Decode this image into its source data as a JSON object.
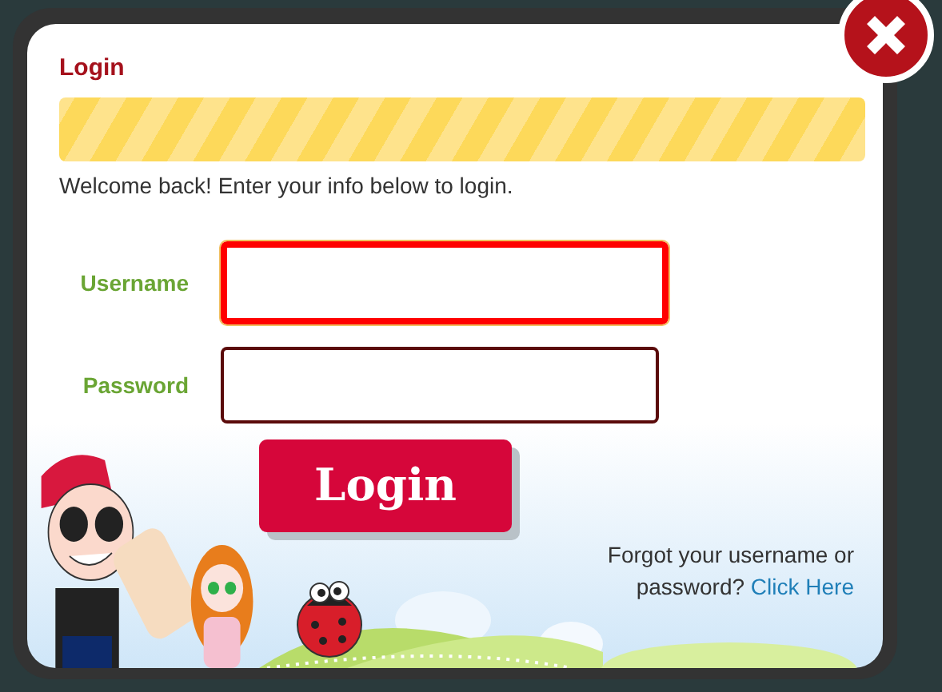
{
  "dialog": {
    "title": "Login",
    "intro": "Welcome back! Enter your info below to login."
  },
  "fields": [
    {
      "label": "Username",
      "focused": true
    },
    {
      "label": "Password",
      "focused": false
    }
  ],
  "submit": {
    "label": "Login"
  },
  "help": {
    "text": "Forgot your username or password?",
    "link": "Click Here"
  }
}
